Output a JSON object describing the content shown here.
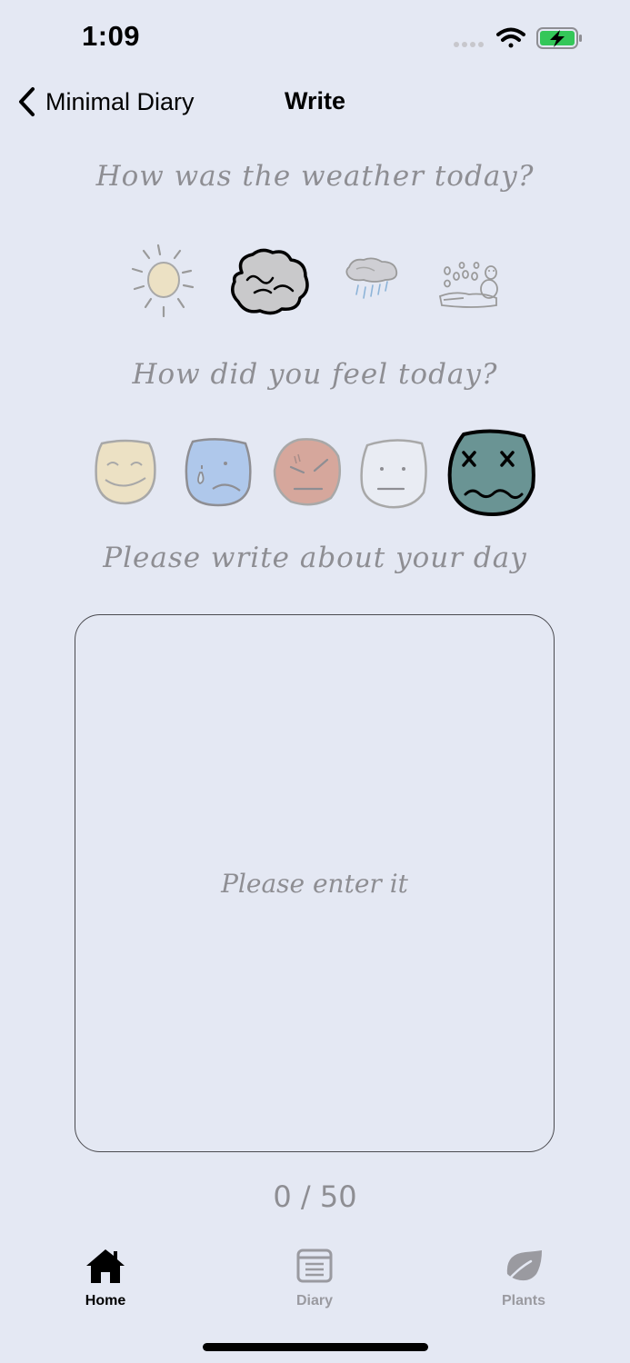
{
  "status_bar": {
    "time": "1:09"
  },
  "nav": {
    "back_label": "Minimal Diary",
    "title": "Write"
  },
  "weather": {
    "question": "How was the weather today?",
    "options": [
      "sunny",
      "cloudy",
      "rainy",
      "snowy"
    ],
    "selected": "cloudy"
  },
  "mood": {
    "question": "How did you feel today?",
    "options": [
      "happy",
      "sad",
      "angry",
      "neutral",
      "sick"
    ],
    "selected": "sick"
  },
  "diary": {
    "prompt": "Please write about your day",
    "placeholder": "Please enter it",
    "counter": "0 / 50"
  },
  "tab_bar": {
    "tabs": [
      {
        "label": "Home",
        "active": true
      },
      {
        "label": "Diary",
        "active": false
      },
      {
        "label": "Plants",
        "active": false
      }
    ]
  },
  "colors": {
    "background": "#E4E8F3",
    "secondary_text": "#8E8E93",
    "battery_green": "#34C759"
  }
}
